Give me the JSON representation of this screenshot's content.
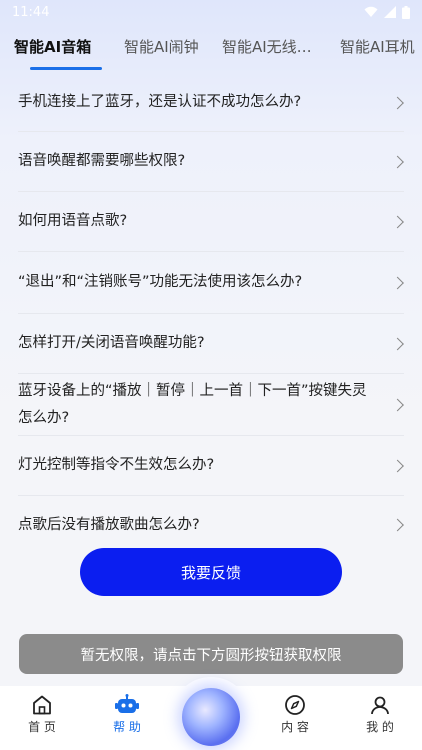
{
  "status_bar": {
    "time": "11:44"
  },
  "tabs": [
    {
      "label": "智能AI音箱",
      "active": true
    },
    {
      "label": "智能AI闹钟",
      "active": false
    },
    {
      "label": "智能AI无线…",
      "active": false
    },
    {
      "label": "智能AI耳机",
      "active": false
    }
  ],
  "faq": [
    "手机连接上了蓝牙，还是认证不成功怎么办?",
    "语音唤醒都需要哪些权限?",
    "如何用语音点歌?",
    "“退出”和“注销账号”功能无法使用该怎么办?",
    "怎样打开/关闭语音唤醒功能?",
    "蓝牙设备上的“播放｜暂停｜上一首｜下一首”按键失灵怎么办?",
    "灯光控制等指令不生效怎么办?",
    "点歌后没有播放歌曲怎么办?"
  ],
  "feedback_button": "我要反馈",
  "permission_notice": "暂无权限，请点击下方圆形按钮获取权限",
  "bottom_nav": {
    "home": "首 页",
    "help": "帮 助",
    "content": "内 容",
    "mine": "我 的"
  },
  "colors": {
    "accent": "#1a6fe8",
    "button": "#0b1ef0",
    "notice_bg": "#8b8b8b"
  }
}
